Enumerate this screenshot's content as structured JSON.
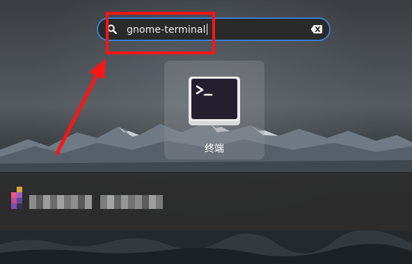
{
  "search": {
    "query": "gnome-terminal",
    "icon": "search-icon",
    "clear_icon": "backspace-clear-icon",
    "accent_color": "#3b7fd1"
  },
  "results": {
    "apps": [
      {
        "label": "终端",
        "icon": "terminal-icon"
      }
    ]
  },
  "annotation": {
    "highlight_color": "#ff1515"
  }
}
